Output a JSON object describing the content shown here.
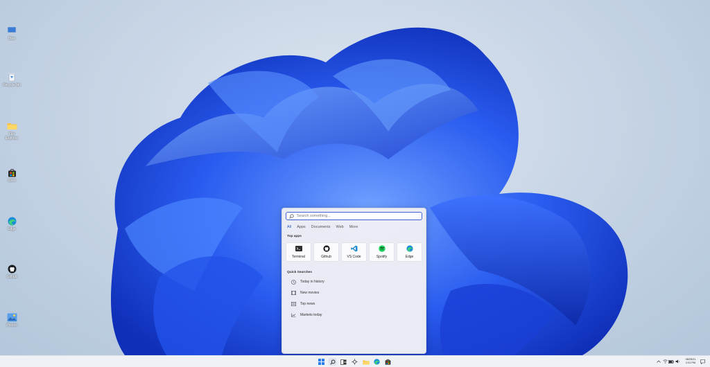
{
  "desktop": {
    "icons": [
      {
        "label": "Blue",
        "icon": "blue-pc-icon"
      },
      {
        "label": "Recycle bin",
        "icon": "recycle-bin-icon"
      },
      {
        "label": "File Explorer",
        "icon": "folder-icon"
      },
      {
        "label": "Store",
        "icon": "store-icon"
      },
      {
        "label": "Edge",
        "icon": "edge-icon"
      },
      {
        "label": "Github",
        "icon": "github-icon"
      },
      {
        "label": "Photos",
        "icon": "photos-icon"
      }
    ]
  },
  "search": {
    "placeholder": "Search something...",
    "tabs": [
      "All",
      "Apps",
      "Documents",
      "Web",
      "More"
    ],
    "active_tab": "All",
    "top_apps_title": "Top apps",
    "top_apps": [
      {
        "label": "Terminal",
        "icon": "terminal-icon"
      },
      {
        "label": "Github",
        "icon": "github-icon"
      },
      {
        "label": "VS Code",
        "icon": "vscode-icon"
      },
      {
        "label": "Spotify",
        "icon": "spotify-icon"
      },
      {
        "label": "Edge",
        "icon": "edge-icon"
      }
    ],
    "quick_searches_title": "Quick Searches",
    "quick_searches": [
      {
        "label": "Today in history",
        "icon": "clock-icon"
      },
      {
        "label": "New movies",
        "icon": "film-icon"
      },
      {
        "label": "Top news",
        "icon": "news-icon"
      },
      {
        "label": "Markets today",
        "icon": "chart-line-icon"
      }
    ]
  },
  "taskbar": {
    "items": [
      "start-icon",
      "search-icon",
      "task-view-icon",
      "widgets-icon",
      "folder-icon",
      "edge-icon",
      "store-icon"
    ],
    "tray_icons": [
      "chevron-up-icon",
      "wifi-icon",
      "battery-icon",
      "volume-icon"
    ],
    "date": "08/25/21",
    "time": "2:01 PM",
    "notification_icon": "notification-icon"
  },
  "colors": {
    "accent": "#3b62d6",
    "wallpaper_blue": "#1f4fe0"
  }
}
